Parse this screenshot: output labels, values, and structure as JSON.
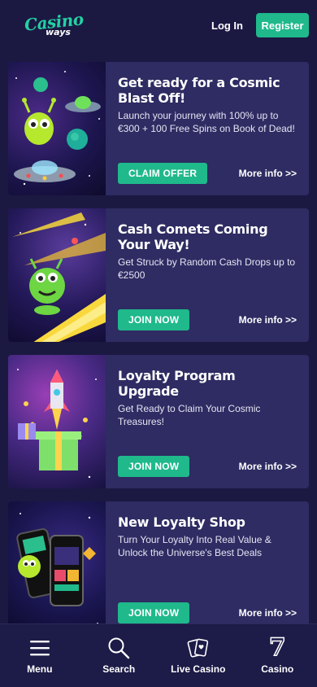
{
  "header": {
    "logo": {
      "line1": "Casino",
      "line2": "ways"
    },
    "login_label": "Log In",
    "register_label": "Register"
  },
  "promos": [
    {
      "title": "Get ready for a Cosmic Blast Off!",
      "description": "Launch your journey with 100% up to €300 + 100 Free Spins on Book of Dead!",
      "cta": "CLAIM OFFER",
      "more": "More info >>",
      "art": "alien-ufo"
    },
    {
      "title": "Cash Comets Coming Your Way!",
      "description": "Get Struck by Random Cash Drops up to €2500",
      "cta": "JOIN NOW",
      "more": "More info >>",
      "art": "alien-comet"
    },
    {
      "title": "Loyalty Program Upgrade",
      "description": "Get Ready to Claim Your Cosmic Treasures!",
      "cta": "JOIN NOW",
      "more": "More info >>",
      "art": "rocket-gift"
    },
    {
      "title": "New Loyalty Shop",
      "description": "Turn Your Loyalty Into Real Value & Unlock the Universe's Best Deals",
      "cta": "JOIN NOW",
      "more": "More info >>",
      "art": "phones-alien"
    }
  ],
  "bottom_nav": [
    {
      "label": "Menu",
      "icon": "menu-icon"
    },
    {
      "label": "Search",
      "icon": "search-icon"
    },
    {
      "label": "Live Casino",
      "icon": "cards-icon"
    },
    {
      "label": "Casino",
      "icon": "seven-icon"
    }
  ],
  "bottom_nav_casino_glyph": "7",
  "colors": {
    "background": "#1b1942",
    "card": "#2e2c62",
    "accent": "#1fb98b",
    "logo": "#25d0a4"
  }
}
